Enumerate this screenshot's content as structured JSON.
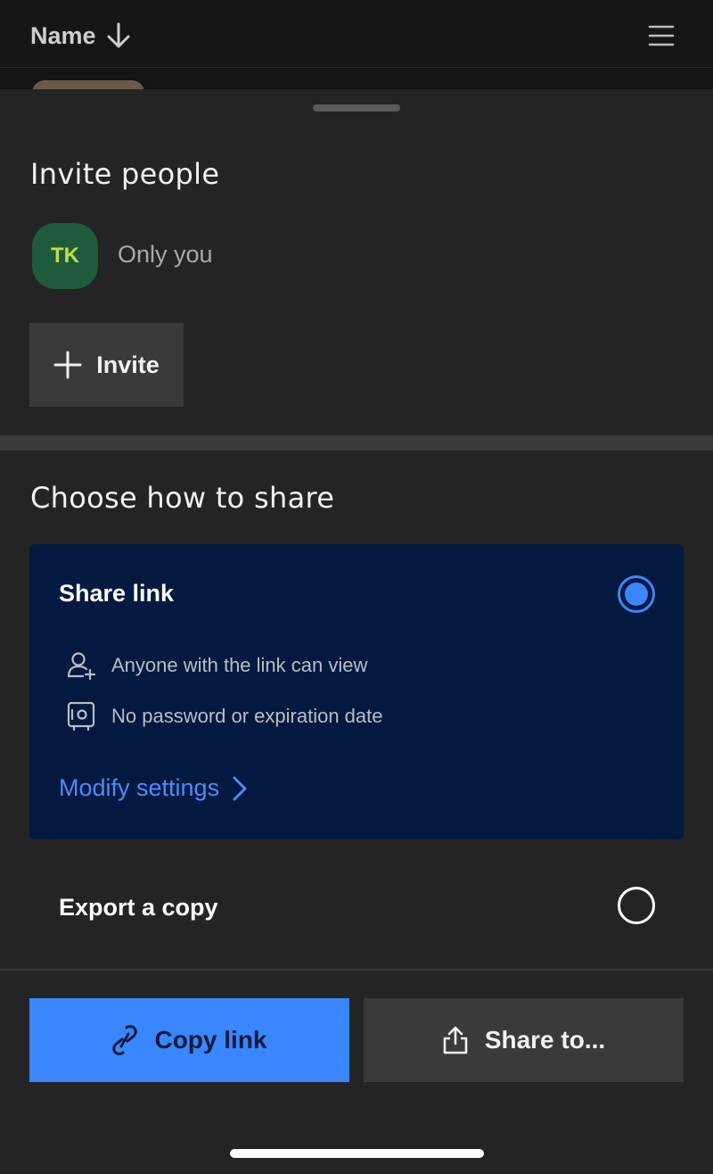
{
  "header": {
    "sort_label": "Name"
  },
  "invite": {
    "title": "Invite people",
    "avatar_initials": "TK",
    "members_text": "Only you",
    "invite_button": "Invite"
  },
  "share": {
    "title": "Choose how to share",
    "share_link": {
      "label": "Share link",
      "selected": true,
      "rows": [
        {
          "icon": "user-add-icon",
          "text": "Anyone with the link can view"
        },
        {
          "icon": "safe-icon",
          "text": "No password or expiration date"
        }
      ],
      "modify_label": "Modify settings"
    },
    "export": {
      "label": "Export a copy",
      "selected": false
    }
  },
  "actions": {
    "copy_link": "Copy link",
    "share_to": "Share to..."
  },
  "colors": {
    "accent": "#3a86ff",
    "card_bg": "#04193f",
    "sheet_bg": "#242424"
  }
}
